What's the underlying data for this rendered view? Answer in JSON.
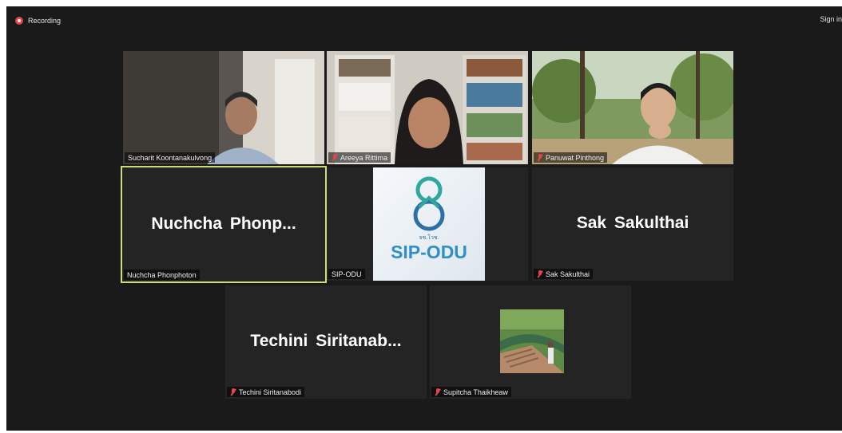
{
  "status": {
    "recording_label": "Recording",
    "sign_in_label": "Sign in"
  },
  "participants": {
    "p1": {
      "tag": "Sucharit Koontanakulvong"
    },
    "p2": {
      "tag": "Areeya Rittima"
    },
    "p3": {
      "tag": "Panuwat Pinthong"
    },
    "p4": {
      "display": "Nuchcha  Phonp...",
      "tag": "Nuchcha Phonphoton"
    },
    "p5": {
      "tag": "SIP-ODU",
      "logo_small": "จช.โวช.",
      "logo_main": "SIP-ODU"
    },
    "p6": {
      "display": "Sak Sakulthai",
      "tag": "Sak Sakulthai"
    },
    "p7": {
      "display": "Techini  Siritanab...",
      "tag": "Techini Siritanabodi"
    },
    "p8": {
      "tag": "Supitcha Thaikheaw"
    }
  }
}
